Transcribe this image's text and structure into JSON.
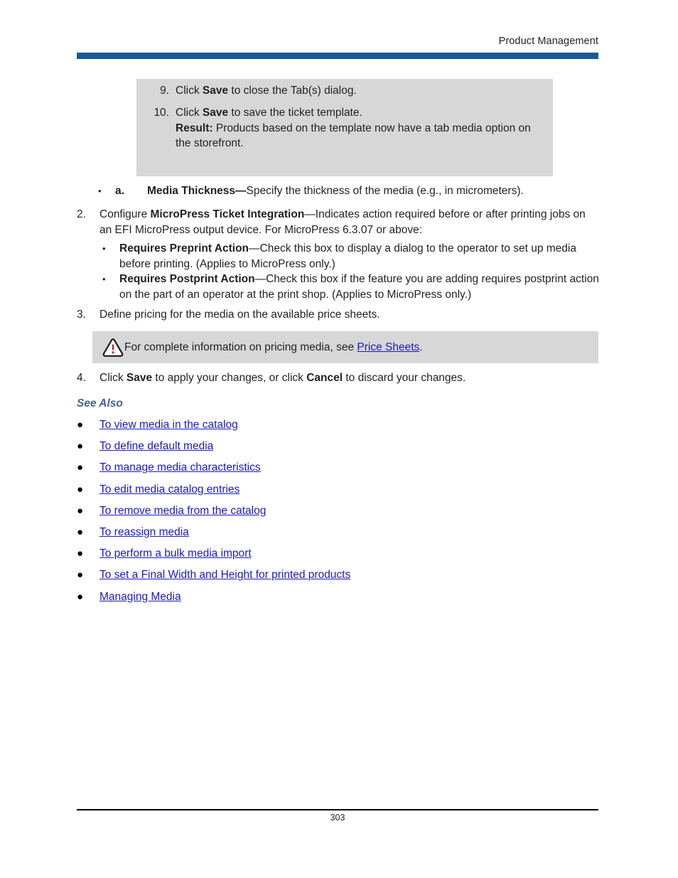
{
  "header": {
    "title": "Product Management",
    "rule_color": "#175a96"
  },
  "callout_box": {
    "background": "#d7d7d7",
    "steps": [
      {
        "number": "9.",
        "text_before": "Click ",
        "bold": "Save",
        "text_after": " to close the Tab(s) dialog."
      },
      {
        "number": "10.",
        "text_before": "Click ",
        "bold": "Save",
        "text_after": " to save the ticket template.",
        "result_label": "Result:",
        "result_text": " Products based on the template now have a tab media option on the storefront."
      }
    ]
  },
  "body": {
    "media_thickness_item": {
      "bullet": "•",
      "letter": "a.",
      "term": "Media Thickness—",
      "text": "Specify the thickness of the media (e.g., in micrometers)."
    },
    "step2": {
      "number": "2.",
      "text_before": "Configure ",
      "term": "MicroPress Ticket Integration",
      "text_after": "—Indicates action required before or after printing jobs on an EFI MicroPress output device. For MicroPress 6.3.07 or above:"
    },
    "sub_bullets": [
      {
        "bullet": "•",
        "term": "Requires Preprint Action",
        "text": "—Check this box to display a dialog to the operator to set up media before printing. (Applies to MicroPress only.)"
      },
      {
        "bullet": "•",
        "term": "Requires Postprint Action",
        "text": "—Check this box if the feature you are adding requires postprint action on the part of an operator at the print shop. (Applies to MicroPress only.)"
      }
    ],
    "step3": {
      "number": "3.",
      "text": "Define pricing for the media on the available price sheets."
    },
    "note": {
      "icon": "warning-triangle-icon",
      "icon_border_color": "#231f20",
      "icon_mark_color": "#cc2222",
      "text_before": "For complete information on pricing media, see ",
      "link": "Price Sheets",
      "text_after": ".",
      "background": "#d7d7d7"
    },
    "step4": {
      "number": "4.",
      "text_before": "Click ",
      "bold1": "Save",
      "text_middle": " to apply your changes, or click ",
      "bold2": "Cancel",
      "text_after": " to discard your changes."
    }
  },
  "see_also": {
    "heading": "See Also",
    "heading_color": "#44628c",
    "link_color": "#1919c4",
    "bullet": "●",
    "links": [
      "To view media in the catalog",
      "To define default media",
      "To manage media characteristics",
      "To edit media catalog entries",
      "To remove media from the catalog",
      "To reassign media",
      "To perform a bulk media import",
      "To set a Final Width and Height for printed products",
      "Managing Media"
    ]
  },
  "footer": {
    "page_number": "303"
  }
}
